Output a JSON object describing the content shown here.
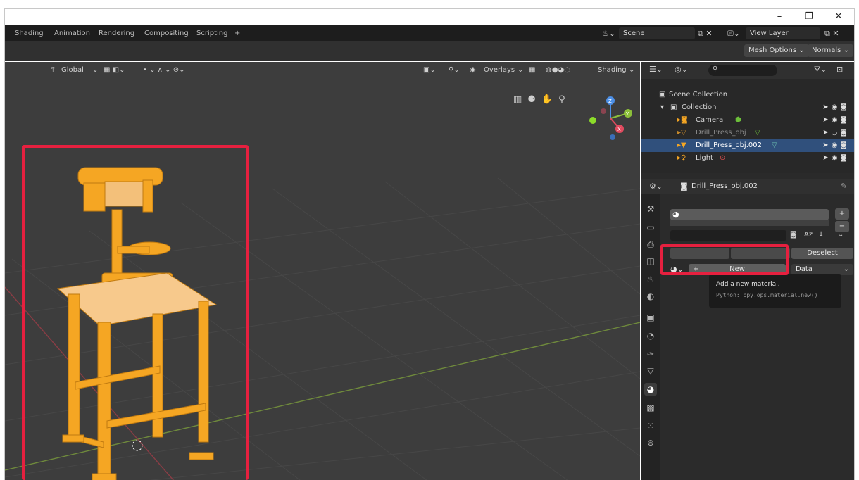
{
  "window": {
    "minimize": "–",
    "restore": "❐",
    "close": "✕"
  },
  "workspaces": {
    "tabs": [
      "Shading",
      "Animation",
      "Rendering",
      "Compositing",
      "Scripting",
      "+"
    ],
    "scene": "Scene",
    "view_layer": "View Layer"
  },
  "tool_header": {
    "mesh_options": "Mesh Options ⌄",
    "normals": "Normals ⌄"
  },
  "viewport_header": {
    "orientation": "Global",
    "overlays": "Overlays",
    "shading": "Shading"
  },
  "gizmo": {
    "z": "Z",
    "y": "Y",
    "x": "X"
  },
  "outliner": {
    "title": "Scene Collection",
    "items": [
      {
        "label": "Collection"
      },
      {
        "label": "Camera"
      },
      {
        "label": "Drill_Press_obj"
      },
      {
        "label": "Drill_Press_obj.002"
      },
      {
        "label": "Light"
      }
    ]
  },
  "properties": {
    "object_name": "Drill_Press_obj.002",
    "deselect_label": "Deselect",
    "new_label": "New",
    "link_label": "Data",
    "az": "Az",
    "tooltip_title": "Add a new material.",
    "tooltip_python": "Python: bpy.ops.material.new()"
  },
  "colors": {
    "highlight": "#e6203f",
    "selection": "#30507c",
    "object": "#f5a623"
  }
}
